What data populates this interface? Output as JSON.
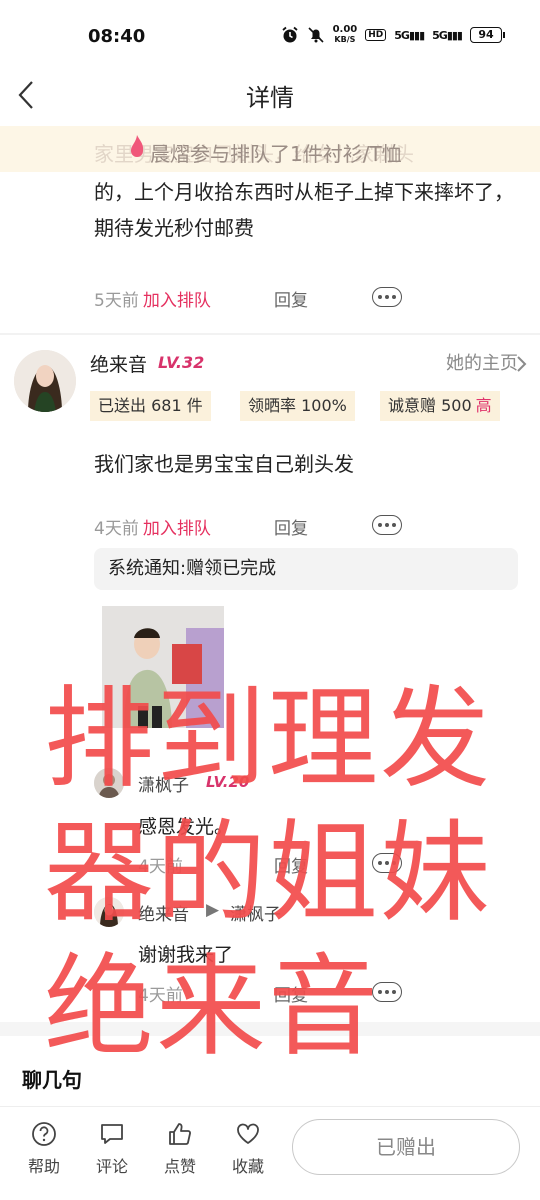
{
  "status_bar": {
    "time": "08:40",
    "net_speed_top": "0.00",
    "net_speed_bottom": "KB/S",
    "hd": "HD",
    "sig1": "5G",
    "sig2": "5G",
    "battery": "94"
  },
  "header": {
    "title": "详情"
  },
  "banner": {
    "background_text": "家里男宝宝自己剃头，给女儿家剃头",
    "notice_text": "晨熠参与排队了1件衬衫/T恤"
  },
  "comment1": {
    "text": "的，上个月收拾东西时从柜子上掉下来摔坏了，期待发光秒付邮费",
    "time": "5天前",
    "queue": "加入排队",
    "reply": "回复"
  },
  "user": {
    "name": "绝来音",
    "level": "LV.32",
    "homepage": "她的主页",
    "tags": [
      {
        "label": "已送出 681 件",
        "badge": ""
      },
      {
        "label": "领晒率 100%",
        "badge": ""
      },
      {
        "label": "诚意赠 500",
        "badge": "高"
      }
    ]
  },
  "comment2": {
    "text": "我们家也是男宝宝自己剃头发",
    "time": "4天前",
    "queue": "加入排队",
    "reply": "回复"
  },
  "system_notice": "系统通知:赠领已完成",
  "subreplies": [
    {
      "name": "潇枫子",
      "level": "LV.20",
      "text": "感恩发光。",
      "time": "4天前",
      "reply": "回复"
    },
    {
      "name": "绝来音",
      "arrow": "▶",
      "target": "潇枫子",
      "text": "谢谢我来了",
      "time": "4天前",
      "reply": "回复"
    }
  ],
  "section_title": "聊几句",
  "overlay_text": [
    "排到理发",
    "器的姐妹",
    "绝来音"
  ],
  "bottom_bar": {
    "tabs": [
      {
        "label": "帮助",
        "icon": "help-icon"
      },
      {
        "label": "评论",
        "icon": "comment-icon"
      },
      {
        "label": "点赞",
        "icon": "like-icon"
      },
      {
        "label": "收藏",
        "icon": "heart-icon"
      }
    ],
    "given_button": "已赠出"
  },
  "colors": {
    "accent": "#e5305f",
    "overlay": "#f24c4c",
    "tag_bg": "#fbf1dc"
  }
}
